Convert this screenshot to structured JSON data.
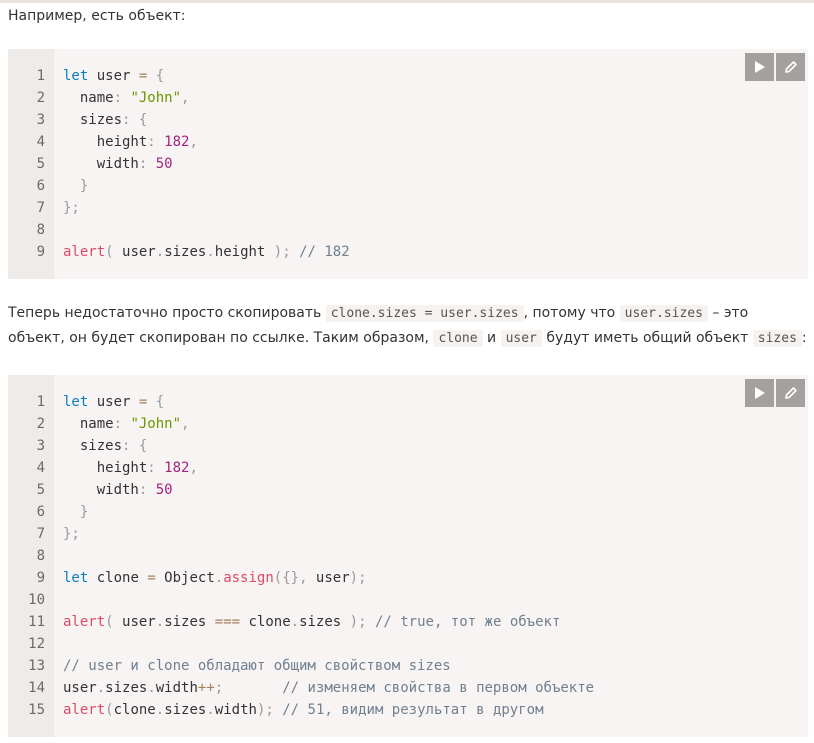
{
  "intro": "Например, есть объект:",
  "block1": {
    "lines": [
      [
        {
          "c": "kw",
          "t": "let"
        },
        {
          "c": "",
          "t": " user "
        },
        {
          "c": "op",
          "t": "="
        },
        {
          "c": "",
          "t": " "
        },
        {
          "c": "pc",
          "t": "{"
        }
      ],
      [
        {
          "c": "",
          "t": "  name"
        },
        {
          "c": "pc",
          "t": ":"
        },
        {
          "c": "",
          "t": " "
        },
        {
          "c": "str",
          "t": "\"John\""
        },
        {
          "c": "pc",
          "t": ","
        }
      ],
      [
        {
          "c": "",
          "t": "  sizes"
        },
        {
          "c": "pc",
          "t": ":"
        },
        {
          "c": "",
          "t": " "
        },
        {
          "c": "pc",
          "t": "{"
        }
      ],
      [
        {
          "c": "",
          "t": "    height"
        },
        {
          "c": "pc",
          "t": ":"
        },
        {
          "c": "",
          "t": " "
        },
        {
          "c": "num",
          "t": "182"
        },
        {
          "c": "pc",
          "t": ","
        }
      ],
      [
        {
          "c": "",
          "t": "    width"
        },
        {
          "c": "pc",
          "t": ":"
        },
        {
          "c": "",
          "t": " "
        },
        {
          "c": "num",
          "t": "50"
        }
      ],
      [
        {
          "c": "pc",
          "t": "  }"
        }
      ],
      [
        {
          "c": "pc",
          "t": "};"
        }
      ],
      [],
      [
        {
          "c": "fn",
          "t": "alert"
        },
        {
          "c": "pc",
          "t": "("
        },
        {
          "c": "",
          "t": " user"
        },
        {
          "c": "pc",
          "t": "."
        },
        {
          "c": "",
          "t": "sizes"
        },
        {
          "c": "pc",
          "t": "."
        },
        {
          "c": "",
          "t": "height "
        },
        {
          "c": "pc",
          "t": ");"
        },
        {
          "c": "",
          "t": " "
        },
        {
          "c": "cm",
          "t": "// 182"
        }
      ]
    ]
  },
  "para2": {
    "t1": "Теперь недостаточно просто скопировать ",
    "c1": "clone.sizes = user.sizes",
    "t2": ", потому что ",
    "c2": "user.sizes",
    "t3": " – это объект, он будет скопирован по ссылке. Таким образом, ",
    "c3": "clone",
    "t4": " и ",
    "c4": "user",
    "t5": " будут иметь общий объект ",
    "c5": "sizes",
    "t6": ":"
  },
  "block2": {
    "lines": [
      [
        {
          "c": "kw",
          "t": "let"
        },
        {
          "c": "",
          "t": " user "
        },
        {
          "c": "op",
          "t": "="
        },
        {
          "c": "",
          "t": " "
        },
        {
          "c": "pc",
          "t": "{"
        }
      ],
      [
        {
          "c": "",
          "t": "  name"
        },
        {
          "c": "pc",
          "t": ":"
        },
        {
          "c": "",
          "t": " "
        },
        {
          "c": "str",
          "t": "\"John\""
        },
        {
          "c": "pc",
          "t": ","
        }
      ],
      [
        {
          "c": "",
          "t": "  sizes"
        },
        {
          "c": "pc",
          "t": ":"
        },
        {
          "c": "",
          "t": " "
        },
        {
          "c": "pc",
          "t": "{"
        }
      ],
      [
        {
          "c": "",
          "t": "    height"
        },
        {
          "c": "pc",
          "t": ":"
        },
        {
          "c": "",
          "t": " "
        },
        {
          "c": "num",
          "t": "182"
        },
        {
          "c": "pc",
          "t": ","
        }
      ],
      [
        {
          "c": "",
          "t": "    width"
        },
        {
          "c": "pc",
          "t": ":"
        },
        {
          "c": "",
          "t": " "
        },
        {
          "c": "num",
          "t": "50"
        }
      ],
      [
        {
          "c": "pc",
          "t": "  }"
        }
      ],
      [
        {
          "c": "pc",
          "t": "};"
        }
      ],
      [],
      [
        {
          "c": "kw",
          "t": "let"
        },
        {
          "c": "",
          "t": " clone "
        },
        {
          "c": "op",
          "t": "="
        },
        {
          "c": "",
          "t": " Object"
        },
        {
          "c": "pc",
          "t": "."
        },
        {
          "c": "fn",
          "t": "assign"
        },
        {
          "c": "pc",
          "t": "({},"
        },
        {
          "c": "",
          "t": " user"
        },
        {
          "c": "pc",
          "t": ");"
        }
      ],
      [],
      [
        {
          "c": "fn",
          "t": "alert"
        },
        {
          "c": "pc",
          "t": "("
        },
        {
          "c": "",
          "t": " user"
        },
        {
          "c": "pc",
          "t": "."
        },
        {
          "c": "",
          "t": "sizes "
        },
        {
          "c": "op",
          "t": "==="
        },
        {
          "c": "",
          "t": " clone"
        },
        {
          "c": "pc",
          "t": "."
        },
        {
          "c": "",
          "t": "sizes "
        },
        {
          "c": "pc",
          "t": ");"
        },
        {
          "c": "",
          "t": " "
        },
        {
          "c": "cm",
          "t": "// true, тот же объект"
        }
      ],
      [],
      [
        {
          "c": "cm",
          "t": "// user и clone обладают общим свойством sizes"
        }
      ],
      [
        {
          "c": "",
          "t": "user"
        },
        {
          "c": "pc",
          "t": "."
        },
        {
          "c": "",
          "t": "sizes"
        },
        {
          "c": "pc",
          "t": "."
        },
        {
          "c": "",
          "t": "width"
        },
        {
          "c": "op",
          "t": "++"
        },
        {
          "c": "pc",
          "t": ";"
        },
        {
          "c": "",
          "t": "       "
        },
        {
          "c": "cm",
          "t": "// изменяем свойства в первом объекте"
        }
      ],
      [
        {
          "c": "fn",
          "t": "alert"
        },
        {
          "c": "pc",
          "t": "("
        },
        {
          "c": "",
          "t": "clone"
        },
        {
          "c": "pc",
          "t": "."
        },
        {
          "c": "",
          "t": "sizes"
        },
        {
          "c": "pc",
          "t": "."
        },
        {
          "c": "",
          "t": "width"
        },
        {
          "c": "pc",
          "t": ");"
        },
        {
          "c": "",
          "t": " "
        },
        {
          "c": "cm",
          "t": "// 51, видим результат в другом"
        }
      ]
    ]
  },
  "icons": {
    "run": "play-icon",
    "edit": "pencil-icon"
  },
  "colors": {
    "block_bg": "#f7f4f3",
    "gutter_bg": "#efebe8",
    "button_bg": "#a3a09d",
    "keyword": "#0a7cc0",
    "string": "#669900",
    "number": "#a2247f",
    "function": "#dd4a68",
    "comment": "#708090"
  }
}
